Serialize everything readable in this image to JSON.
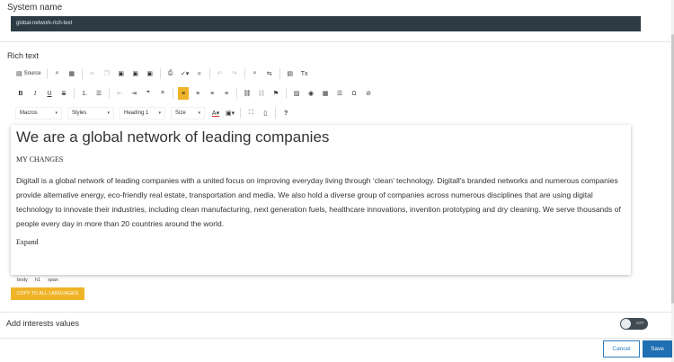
{
  "system": {
    "label": "System name",
    "value": "global-network-rich-text"
  },
  "rich_text": {
    "label": "Rich text",
    "toolbar": {
      "row1": [
        {
          "icon": "source-icon",
          "glyph": "▤",
          "label": "Source",
          "disabled": false
        },
        {
          "sep": true
        },
        {
          "icon": "preview-icon",
          "glyph": "⌕",
          "label": "",
          "disabled": false
        },
        {
          "icon": "templates-icon",
          "glyph": "▦",
          "label": "",
          "disabled": false
        },
        {
          "sep": true
        },
        {
          "icon": "cut-icon",
          "glyph": "✂",
          "label": "",
          "disabled": true
        },
        {
          "icon": "copy-icon",
          "glyph": "❐",
          "label": "",
          "disabled": true
        },
        {
          "icon": "paste-icon",
          "glyph": "▣",
          "label": "",
          "disabled": false
        },
        {
          "icon": "paste-text-icon",
          "glyph": "▣",
          "label": "",
          "disabled": false
        },
        {
          "icon": "paste-word-icon",
          "glyph": "▣",
          "label": "",
          "disabled": false
        },
        {
          "sep": true
        },
        {
          "icon": "print-icon",
          "glyph": "⎙",
          "label": "",
          "disabled": false
        },
        {
          "icon": "spellcheck-icon",
          "glyph": "✓▾",
          "label": "",
          "disabled": false
        },
        {
          "icon": "flash-icon",
          "glyph": "■",
          "label": "",
          "disabled": true
        },
        {
          "sep": true
        },
        {
          "icon": "undo-icon",
          "glyph": "↶",
          "label": "",
          "disabled": true
        },
        {
          "icon": "redo-icon",
          "glyph": "↷",
          "label": "",
          "disabled": true
        },
        {
          "sep": true
        },
        {
          "icon": "find-icon",
          "glyph": "⌕",
          "label": "",
          "disabled": false
        },
        {
          "icon": "replace-icon",
          "glyph": "⇆",
          "label": "",
          "disabled": false
        },
        {
          "sep": true
        },
        {
          "icon": "select-all-icon",
          "glyph": "▤",
          "label": "",
          "disabled": false
        },
        {
          "icon": "remove-format-icon",
          "glyph": "Tx",
          "label": "",
          "disabled": false
        }
      ],
      "row2": [
        {
          "icon": "bold-icon",
          "glyph": "B",
          "style": "font-weight:bold;",
          "disabled": false
        },
        {
          "icon": "italic-icon",
          "glyph": "I",
          "style": "font-style:italic;font-family:'Liberation Serif',serif;",
          "disabled": false
        },
        {
          "icon": "underline-icon",
          "glyph": "U",
          "style": "text-decoration:underline;",
          "disabled": false
        },
        {
          "icon": "strikethrough-icon",
          "glyph": "S",
          "style": "text-decoration:line-through;",
          "disabled": false
        },
        {
          "sep": true
        },
        {
          "icon": "numbered-list-icon",
          "glyph": "⒈",
          "disabled": false
        },
        {
          "icon": "bulleted-list-icon",
          "glyph": "☰",
          "disabled": false
        },
        {
          "sep": true
        },
        {
          "icon": "outdent-icon",
          "glyph": "⇤",
          "disabled": true
        },
        {
          "icon": "indent-icon",
          "glyph": "⇥",
          "disabled": false
        },
        {
          "icon": "blockquote-icon",
          "glyph": "❞",
          "disabled": false
        },
        {
          "icon": "div-icon",
          "glyph": "⌗",
          "disabled": false
        },
        {
          "sep": true
        },
        {
          "icon": "align-left-icon",
          "glyph": "≡",
          "disabled": false,
          "active": true
        },
        {
          "icon": "align-center-icon",
          "glyph": "≡",
          "disabled": false
        },
        {
          "icon": "align-right-icon",
          "glyph": "≡",
          "disabled": false
        },
        {
          "icon": "align-justify-icon",
          "glyph": "≡",
          "disabled": false
        },
        {
          "sep": true
        },
        {
          "icon": "link-icon",
          "glyph": "⛓",
          "disabled": false
        },
        {
          "icon": "unlink-icon",
          "glyph": "⛓",
          "disabled": true
        },
        {
          "icon": "anchor-icon",
          "glyph": "⚑",
          "disabled": false
        },
        {
          "sep": true
        },
        {
          "icon": "image-icon",
          "glyph": "▨",
          "disabled": false
        },
        {
          "icon": "flash-embed-icon",
          "glyph": "◉",
          "disabled": false
        },
        {
          "icon": "table-icon",
          "glyph": "▦",
          "disabled": false
        },
        {
          "icon": "horizontal-rule-icon",
          "glyph": "☰",
          "disabled": false
        },
        {
          "icon": "special-char-icon",
          "glyph": "Ω",
          "disabled": false
        },
        {
          "icon": "iframe-icon",
          "glyph": "⊘",
          "disabled": false
        }
      ],
      "row3": [
        {
          "combo": true,
          "name": "macros-combo",
          "label": "Macros",
          "width": 52
        },
        {
          "combo": true,
          "name": "styles-combo",
          "label": "Styles",
          "width": 52
        },
        {
          "combo": true,
          "name": "format-combo",
          "label": "Heading 1",
          "width": 51
        },
        {
          "combo": true,
          "name": "size-combo",
          "label": "Size",
          "width": 38
        },
        {
          "icon": "text-color-icon",
          "glyph": "A▾",
          "disabled": false,
          "style": "text-decoration:underline;text-decoration-color:#d33;"
        },
        {
          "icon": "bg-color-icon",
          "glyph": "▣▾",
          "disabled": false
        },
        {
          "sep": true
        },
        {
          "icon": "maximize-icon",
          "glyph": "⛶",
          "disabled": false
        },
        {
          "icon": "show-blocks-icon",
          "glyph": "▯",
          "disabled": false
        },
        {
          "sep": true
        },
        {
          "icon": "about-icon",
          "glyph": "?",
          "disabled": false,
          "style": "font-weight:bold;"
        }
      ]
    },
    "content": {
      "heading": "We are a global network of leading companies",
      "changes": "MY CHANGES",
      "paragraph": "Digitall is a global network of leading companies with a united focus on improving everyday living through ‘clean’ technology. Digitall's branded networks and numerous companies provide alternative energy, eco-friendly real estate, transportation and media. We also hold a diverse group of companies across numerous disciplines that are using digital technology to innovate their industries, including clean manufacturing, next generation fuels, healthcare innovations, invention prototyping and dry cleaning. We serve thousands of people every day in more than 20 countries around the world.",
      "expand": "Expand"
    },
    "path": [
      "body",
      "h1",
      "span"
    ],
    "copy_button": "COPY TO ALL LANGUAGES"
  },
  "interests": {
    "label": "Add interests values",
    "toggle_state": "OFF"
  },
  "footer": {
    "cancel": "Cancel",
    "save": "Save"
  },
  "colors": {
    "accent": "#f0b429",
    "dark_input": "#2e3b45",
    "primary": "#1f6fb2"
  }
}
